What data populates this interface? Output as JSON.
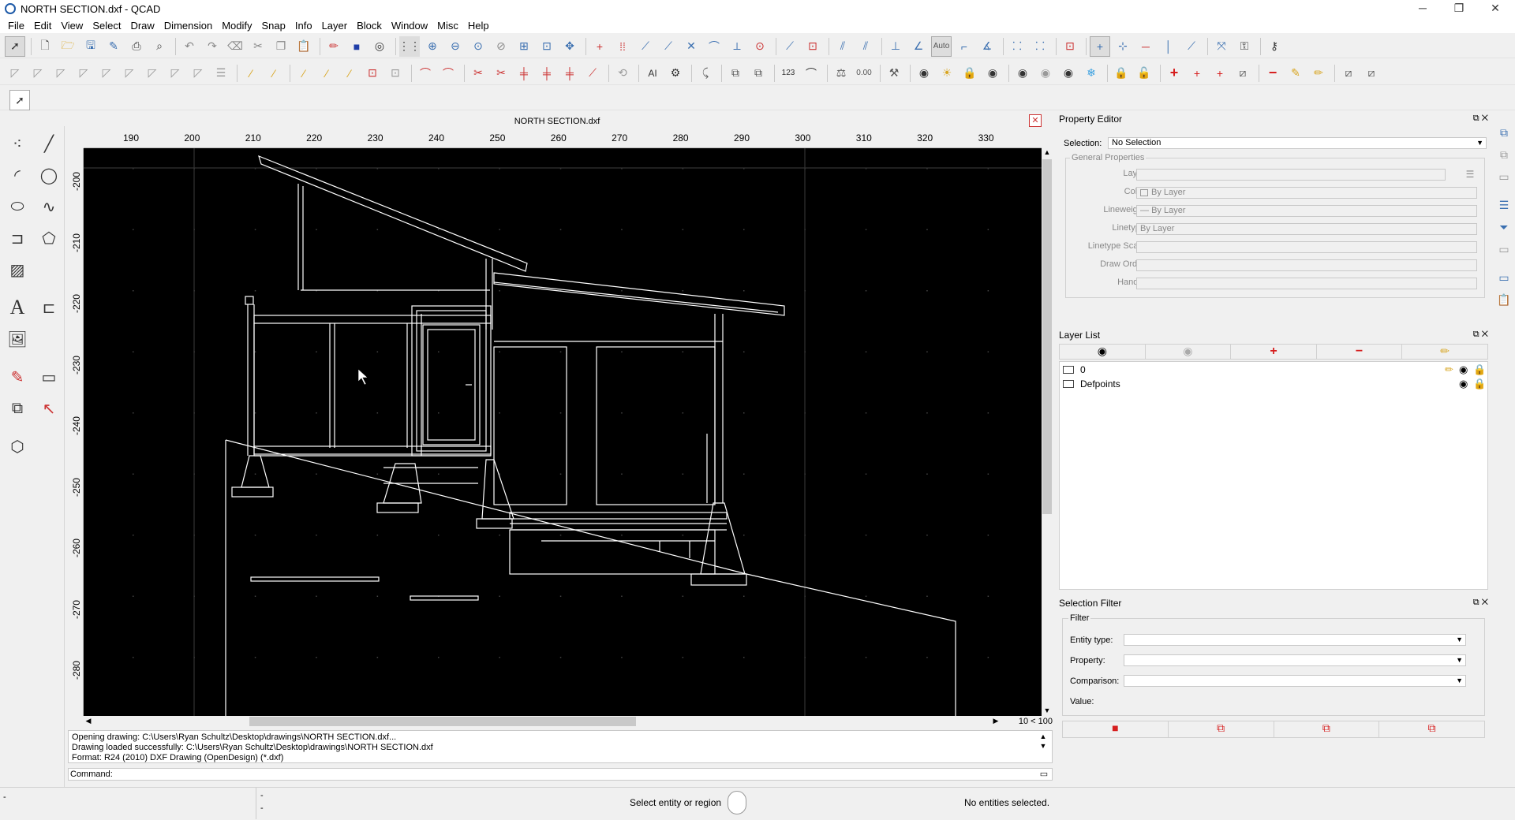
{
  "window": {
    "title": "NORTH SECTION.dxf - QCAD",
    "minimize": "─",
    "restore": "❐",
    "close": "✕"
  },
  "menus": [
    "File",
    "Edit",
    "View",
    "Select",
    "Draw",
    "Dimension",
    "Modify",
    "Snap",
    "Info",
    "Layer",
    "Block",
    "Window",
    "Misc",
    "Help"
  ],
  "toolbar": {
    "auto_label": "Auto",
    "numeric_label": "123",
    "decimal_label": "0.00"
  },
  "drawing": {
    "title": "NORTH SECTION.dxf",
    "ruler_x_labels": [
      "190",
      "200",
      "210",
      "220",
      "230",
      "240",
      "250",
      "260",
      "270",
      "280",
      "290",
      "300",
      "310",
      "320",
      "330"
    ],
    "ruler_y_labels": [
      "-200",
      "-210",
      "-220",
      "-230",
      "-240",
      "-250",
      "-260",
      "-270",
      "-280"
    ],
    "zoom_label": "10 < 100"
  },
  "console": {
    "lines": [
      "Opening drawing: C:\\Users\\Ryan Schultz\\Desktop\\drawings\\NORTH SECTION.dxf...",
      "Drawing loaded successfully: C:\\Users\\Ryan Schultz\\Desktop\\drawings\\NORTH SECTION.dxf",
      "Format: R24 (2010) DXF Drawing (OpenDesign) (*.dxf)"
    ],
    "command_label": "Command:"
  },
  "status": {
    "dash1": "-",
    "dash2": "-",
    "dash3": "-",
    "prompt": "Select entity or region",
    "selection": "No entities selected."
  },
  "property_editor": {
    "title": "Property Editor",
    "selection_label": "Selection:",
    "selection_value": "No Selection",
    "group_title": "General Properties",
    "fields": [
      {
        "label": "Layer:",
        "value": ""
      },
      {
        "label": "Color:",
        "value": "By Layer"
      },
      {
        "label": "Lineweight:",
        "value": "By Layer"
      },
      {
        "label": "Linetype:",
        "value": "By Layer"
      },
      {
        "label": "Linetype Scale:",
        "value": ""
      },
      {
        "label": "Draw Order:",
        "value": ""
      },
      {
        "label": "Handle:",
        "value": ""
      }
    ]
  },
  "layer_list": {
    "title": "Layer List",
    "layers": [
      {
        "name": "0"
      },
      {
        "name": "Defpoints"
      }
    ]
  },
  "selection_filter": {
    "title": "Selection Filter",
    "group_title": "Filter",
    "fields": [
      {
        "label": "Entity type:"
      },
      {
        "label": "Property:"
      },
      {
        "label": "Comparison:"
      },
      {
        "label": "Value:"
      }
    ]
  },
  "colors": {
    "canvas": "#000000",
    "drawing_lines": "#ffffff",
    "accent_red": "#d61e1e",
    "accent_blue": "#3a6fb0"
  }
}
